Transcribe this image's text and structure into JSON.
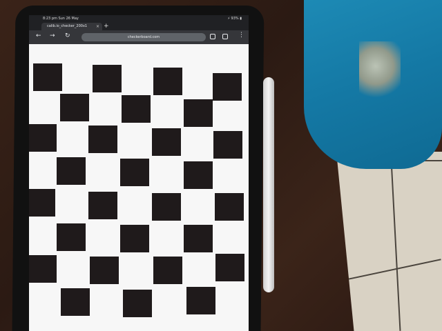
{
  "scene": {
    "description_colors": {
      "table": "#2b1a13",
      "bag": "#1478a4",
      "floor": "#d9d2c4",
      "square": "#1f1a1b",
      "screen": "#f7f7f7"
    }
  },
  "browser": {
    "status_time": "8:23 pm",
    "status_date": "Sun 26 May",
    "status_right": "⚡ 93% ▮",
    "tab_title": "calib.io_checker_200x1",
    "tab_close": "×",
    "new_tab": "+",
    "back_icon": "←",
    "forward_icon": "→",
    "reload_icon": "↻",
    "url": "checkerboard.com",
    "menu": "⋮"
  }
}
